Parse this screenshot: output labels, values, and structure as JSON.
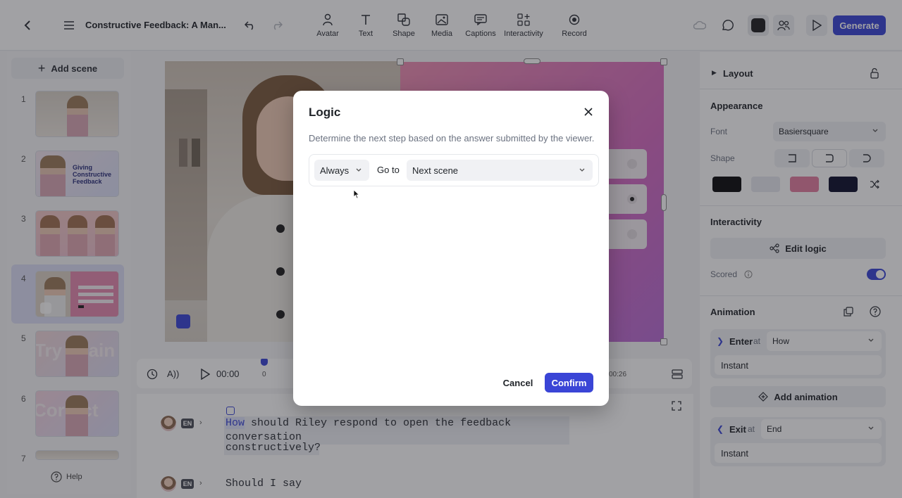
{
  "header": {
    "project_title": "Constructive Feedback: A Man...",
    "tools": [
      {
        "label": "Avatar",
        "icon": "avatar-icon"
      },
      {
        "label": "Text",
        "icon": "text-icon"
      },
      {
        "label": "Shape",
        "icon": "shape-icon"
      },
      {
        "label": "Media",
        "icon": "media-icon"
      },
      {
        "label": "Captions",
        "icon": "captions-icon"
      },
      {
        "label": "Interactivity",
        "icon": "interactivity-icon"
      },
      {
        "label": "Record",
        "icon": "record-icon"
      }
    ],
    "generate_label": "Generate"
  },
  "sidebar": {
    "add_scene_label": "Add scene",
    "scenes": [
      {
        "number": "1"
      },
      {
        "number": "2",
        "thumb_lines": [
          "Giving",
          "Constructive",
          "Feedback"
        ]
      },
      {
        "number": "3"
      },
      {
        "number": "4",
        "selected": true
      },
      {
        "number": "5",
        "thumb_text": "Try again"
      },
      {
        "number": "6",
        "thumb_text": "Correct"
      },
      {
        "number": "7"
      }
    ],
    "help_label": "Help"
  },
  "timeline": {
    "time": "00:00",
    "start_tick": "0",
    "end_tick": "00:26"
  },
  "script": {
    "lines": [
      {
        "lang": "EN",
        "text_highlight": "How",
        "text_rest": " should Riley respond to open the feedback conversation",
        "text_line2": "constructively?"
      },
      {
        "lang": "EN",
        "text_rest": "Should I say"
      }
    ]
  },
  "right_panel": {
    "layout_label": "Layout",
    "appearance_label": "Appearance",
    "font_label": "Font",
    "font_value": "Basiersquare",
    "shape_label": "Shape",
    "swatches": [
      "#0b0b0d",
      "#e7e9f0",
      "#e47fa0",
      "#0d0f2b"
    ],
    "interactivity_label": "Interactivity",
    "edit_logic_label": "Edit logic",
    "scored_label": "Scored",
    "scored_on": true,
    "animation_label": "Animation",
    "enter_label": "Enter",
    "enter_at": "at",
    "enter_value": "How",
    "enter_type": "Instant",
    "add_animation_label": "Add animation",
    "exit_label": "Exit",
    "exit_at": "at",
    "exit_value": "End",
    "exit_type": "Instant"
  },
  "modal": {
    "title": "Logic",
    "description": "Determine the next step based on the answer submitted by the viewer.",
    "condition_value": "Always",
    "goto_label": "Go to",
    "target_value": "Next scene",
    "cancel_label": "Cancel",
    "confirm_label": "Confirm"
  },
  "colors": {
    "accent": "#3a45d6"
  }
}
